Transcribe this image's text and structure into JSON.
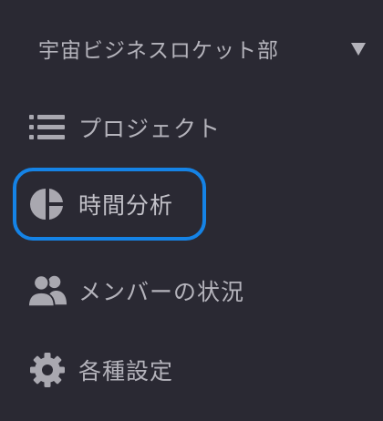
{
  "workspace": {
    "name": "宇宙ビジネスロケット部",
    "dropdown_icon": "caret-down-icon"
  },
  "nav": {
    "items": [
      {
        "label": "プロジェクト",
        "icon": "list-icon",
        "active": false
      },
      {
        "label": "時間分析",
        "icon": "pie-chart-icon",
        "active": true
      },
      {
        "label": "メンバーの状況",
        "icon": "people-icon",
        "active": false
      },
      {
        "label": "各種設定",
        "icon": "gear-icon",
        "active": false
      }
    ]
  },
  "colors": {
    "background": "#2a2933",
    "text": "#b4b3bb",
    "icon": "#a9a8b0",
    "active_outline": "#1583e6"
  }
}
